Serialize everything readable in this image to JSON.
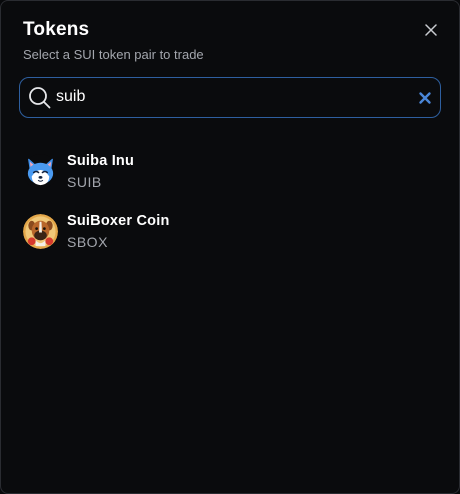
{
  "header": {
    "title": "Tokens",
    "subtitle": "Select a SUI token pair to trade"
  },
  "search": {
    "value": "suib",
    "icon": "search-icon",
    "clear_icon": "clear-x-icon"
  },
  "tokens": [
    {
      "name": "Suiba Inu",
      "symbol": "SUIB",
      "icon": "suiba-inu-logo"
    },
    {
      "name": "SuiBoxer Coin",
      "symbol": "SBOX",
      "icon": "suiboxer-logo"
    }
  ],
  "colors": {
    "background": "#0a0b0d",
    "accent": "#2e5f9f",
    "clear_icon": "#4a86d8",
    "muted_text": "#a3a6ad"
  }
}
